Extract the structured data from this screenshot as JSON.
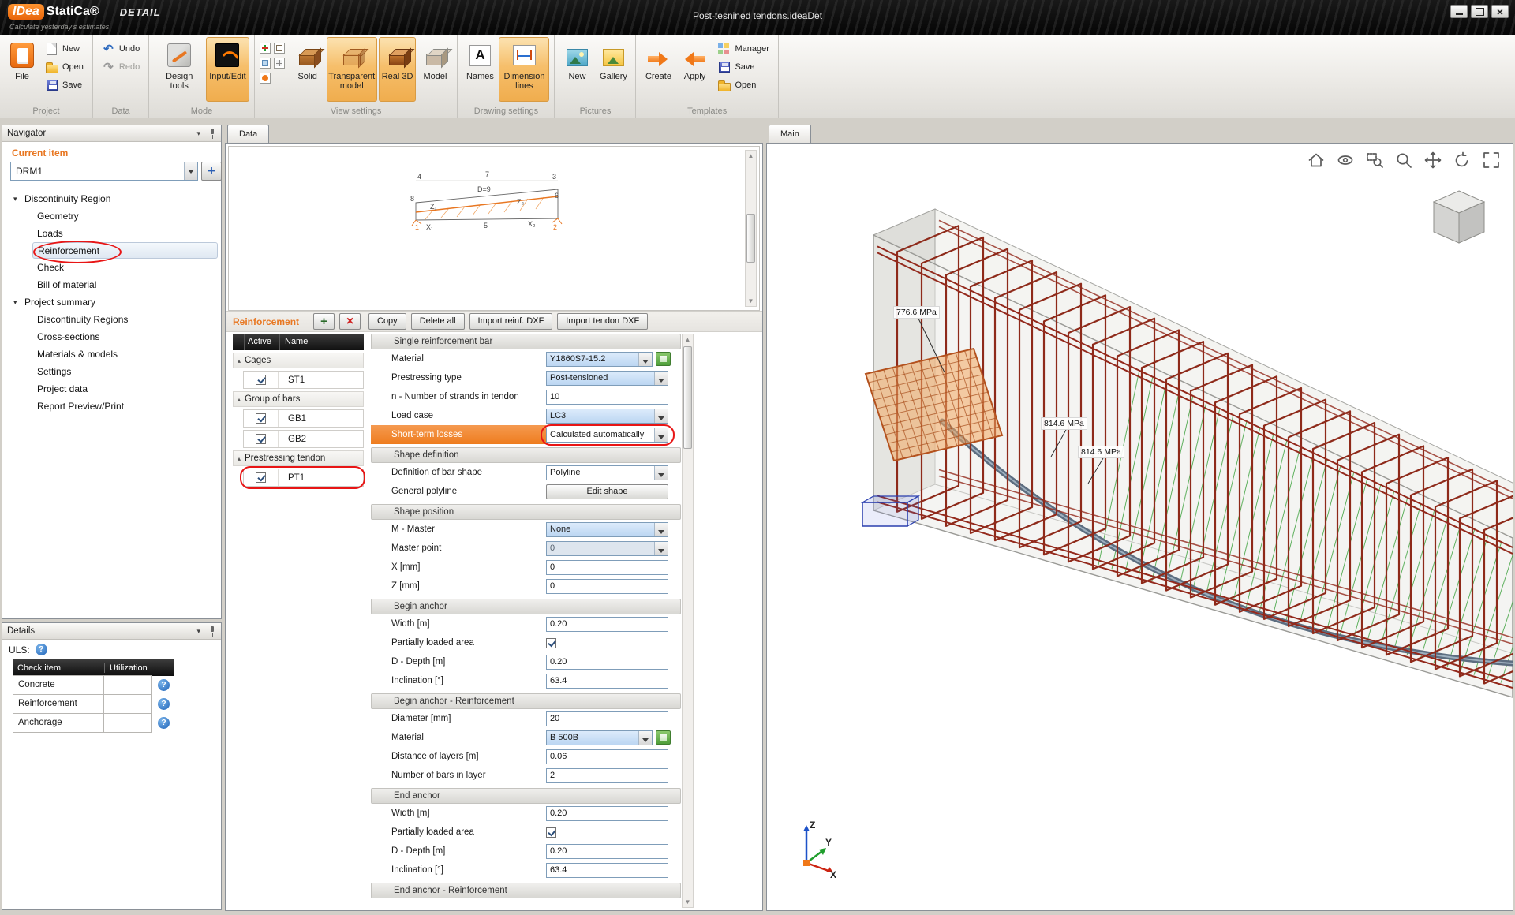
{
  "titlebar": {
    "logo_idea": "IDea",
    "logo_statica": "StatiCa®",
    "mode": "DETAIL",
    "tagline": "Calculate yesterday's estimates",
    "document_title": "Post-tesnined tendons.ideaDet"
  },
  "window_controls": [
    "minimize",
    "maximize",
    "close"
  ],
  "ribbon": {
    "groups": [
      {
        "label": "Project",
        "large": [
          {
            "label": "File",
            "icon": "file-icon"
          }
        ],
        "small": [
          {
            "label": "New",
            "icon": "new-page-icon"
          },
          {
            "label": "Open",
            "icon": "open-folder-icon"
          },
          {
            "label": "Save",
            "icon": "save-icon"
          }
        ]
      },
      {
        "label": "Data",
        "small": [
          {
            "label": "Undo",
            "icon": "undo-icon"
          },
          {
            "label": "Redo",
            "icon": "redo-icon",
            "state": "disabled"
          }
        ]
      },
      {
        "label": "Mode",
        "large": [
          {
            "label": "Design tools",
            "icon": "design-tools-icon"
          },
          {
            "label": "Input/Edit",
            "icon": "input-edit-icon",
            "state": "highlighted"
          }
        ]
      },
      {
        "label": "View settings",
        "minis": [
          "mini-axes-icon",
          "mini-cube-icon",
          "mini-plane-icon",
          "mini-grid-icon",
          "mini-origin-icon"
        ],
        "large": [
          {
            "label": "Solid",
            "icon": "solid-icon"
          },
          {
            "label": "Transparent model",
            "icon": "transparent-model-icon",
            "state": "highlighted"
          },
          {
            "label": "Real 3D",
            "icon": "real-3d-icon",
            "state": "highlighted"
          },
          {
            "label": "Model",
            "icon": "model-icon"
          }
        ]
      },
      {
        "label": "Drawing settings",
        "large": [
          {
            "label": "Names",
            "icon": "names-icon"
          },
          {
            "label": "Dimension lines",
            "icon": "dimension-lines-icon",
            "state": "highlighted"
          }
        ]
      },
      {
        "label": "Pictures",
        "large": [
          {
            "label": "New",
            "icon": "picture-new-icon"
          },
          {
            "label": "Gallery",
            "icon": "gallery-icon"
          }
        ]
      },
      {
        "label": "Templates",
        "large": [
          {
            "label": "Create",
            "icon": "create-arrow-icon"
          },
          {
            "label": "Apply",
            "icon": "apply-arrow-icon"
          }
        ],
        "small": [
          {
            "label": "Manager",
            "icon": "manager-icon"
          },
          {
            "label": "Save",
            "icon": "save-icon"
          },
          {
            "label": "Open",
            "icon": "open-folder-icon"
          }
        ]
      }
    ]
  },
  "navigator": {
    "header": "Navigator",
    "current_item_label": "Current item",
    "current_item_value": "DRM1",
    "tree": [
      {
        "label": "Discontinuity Region",
        "level": 0,
        "expanded": true
      },
      {
        "label": "Geometry",
        "level": 1
      },
      {
        "label": "Loads",
        "level": 1
      },
      {
        "label": "Reinforcement",
        "level": 1,
        "selected": true,
        "annotated": true
      },
      {
        "label": "Check",
        "level": 1
      },
      {
        "label": "Bill of material",
        "level": 1
      },
      {
        "label": "Project summary",
        "level": 0,
        "expanded": true
      },
      {
        "label": "Discontinuity Regions",
        "level": 1
      },
      {
        "label": "Cross-sections",
        "level": 1
      },
      {
        "label": "Materials & models",
        "level": 1
      },
      {
        "label": "Settings",
        "level": 1
      },
      {
        "label": "Project data",
        "level": 1
      },
      {
        "label": "Report Preview/Print",
        "level": 1
      }
    ]
  },
  "details": {
    "header": "Details",
    "uls_label": "ULS:",
    "table": {
      "columns": [
        "Check item",
        "Utilization"
      ],
      "rows": [
        "Concrete",
        "Reinforcement",
        "Anchorage"
      ]
    }
  },
  "data_panel": {
    "tab": "Data",
    "diagram": {
      "labels": [
        "4",
        "7",
        "3",
        "8",
        "D=9",
        "6",
        "Z₁",
        "Z₂",
        "1",
        "X₁",
        "5",
        "X₂",
        "2"
      ]
    },
    "toolbar": {
      "title": "Reinforcement",
      "icon_buttons": [
        {
          "name": "add-reinforcement-button",
          "icon": "plus-icon"
        },
        {
          "name": "delete-reinforcement-button",
          "icon": "x-icon"
        }
      ],
      "buttons": [
        "Copy",
        "Delete all",
        "Import reinf. DXF",
        "Import tendon DXF"
      ]
    },
    "grid": {
      "columns": [
        "Active",
        "Name"
      ],
      "groups": [
        {
          "label": "Cages",
          "items": [
            {
              "name": "ST1",
              "active": true
            }
          ]
        },
        {
          "label": "Group of bars",
          "items": [
            {
              "name": "GB1",
              "active": true
            },
            {
              "name": "GB2",
              "active": true
            }
          ]
        },
        {
          "label": "Prestressing tendon",
          "items": [
            {
              "name": "PT1",
              "active": true,
              "annotated": true
            }
          ]
        }
      ]
    },
    "properties": {
      "sections": [
        {
          "title": "Single reinforcement bar",
          "rows": [
            {
              "label": "Material",
              "value": "Y1860S7-15.2",
              "type": "select-edit",
              "selected": true
            },
            {
              "label": "Prestressing type",
              "value": "Post-tensioned",
              "type": "select",
              "selected": true
            },
            {
              "label": "n - Number of strands in tendon",
              "value": "10",
              "type": "input"
            },
            {
              "label": "Load case",
              "value": "LC3",
              "type": "select",
              "selected": true
            },
            {
              "label": "Short-term losses",
              "value": "Calculated automatically",
              "type": "select",
              "highlight": true,
              "circled": true
            }
          ]
        },
        {
          "title": "Shape definition",
          "rows": [
            {
              "label": "Definition of bar shape",
              "value": "Polyline",
              "type": "select"
            },
            {
              "label": "General polyline",
              "value": "Edit shape",
              "type": "button"
            }
          ]
        },
        {
          "title": "Shape position",
          "rows": [
            {
              "label": "M - Master",
              "value": "None",
              "type": "select",
              "selected": true
            },
            {
              "label": "Master point",
              "value": "0",
              "type": "select-disabled"
            },
            {
              "label": "X [mm]",
              "value": "0",
              "type": "input"
            },
            {
              "label": "Z [mm]",
              "value": "0",
              "type": "input"
            }
          ]
        },
        {
          "title": "Begin anchor",
          "rows": [
            {
              "label": "Width [m]",
              "value": "0.20",
              "type": "input"
            },
            {
              "label": "Partially loaded area",
              "value": "checked",
              "type": "checkbox"
            },
            {
              "label": "D - Depth [m]",
              "value": "0.20",
              "type": "input"
            },
            {
              "label": "Inclination [°]",
              "value": "63.4",
              "type": "input"
            }
          ]
        },
        {
          "title": "Begin anchor - Reinforcement",
          "rows": [
            {
              "label": "Diameter [mm]",
              "value": "20",
              "type": "input"
            },
            {
              "label": "Material",
              "value": "B 500B",
              "type": "select-edit",
              "selected": true
            },
            {
              "label": "Distance of layers [m]",
              "value": "0.06",
              "type": "input"
            },
            {
              "label": "Number of bars in layer",
              "value": "2",
              "type": "input"
            }
          ]
        },
        {
          "title": "End anchor",
          "rows": [
            {
              "label": "Width [m]",
              "value": "0.20",
              "type": "input"
            },
            {
              "label": "Partially loaded area",
              "value": "checked",
              "type": "checkbox"
            },
            {
              "label": "D - Depth [m]",
              "value": "0.20",
              "type": "input"
            },
            {
              "label": "Inclination [°]",
              "value": "63.4",
              "type": "input"
            }
          ]
        },
        {
          "title": "End anchor - Reinforcement",
          "rows": []
        }
      ]
    }
  },
  "main_panel": {
    "tab": "Main",
    "viewport_tools": [
      "home-icon",
      "orbit-icon",
      "zoom-window-icon",
      "zoom-icon",
      "pan-icon",
      "rotate-icon",
      "fullscreen-icon"
    ],
    "stress_labels": [
      "776.6 MPa",
      "814.6 MPa",
      "814.6 MPa"
    ],
    "axes": [
      "Z",
      "Y",
      "X"
    ]
  }
}
